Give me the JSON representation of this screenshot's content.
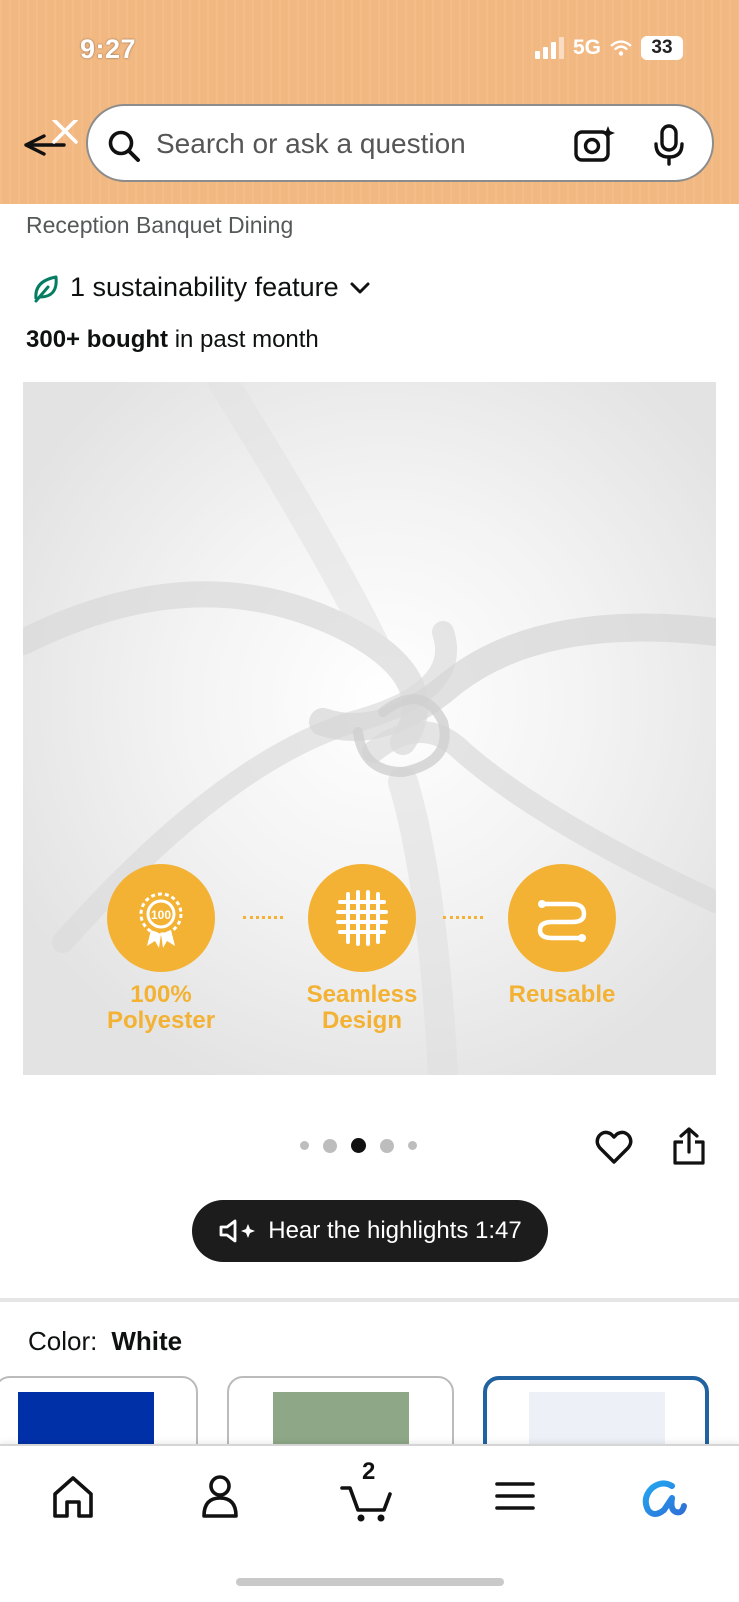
{
  "status_bar": {
    "time": "9:27",
    "network": "5G",
    "battery": "33"
  },
  "search": {
    "placeholder": "Search or ask a question"
  },
  "product": {
    "title_line": "Reception Banquet Dining",
    "sustainability": "1 sustainability feature",
    "bought_bold": "300+ bought",
    "bought_rest": " in past month",
    "image_features": [
      {
        "line1": "100%",
        "line2": "Polyester",
        "icon": "badge-100-icon"
      },
      {
        "line1": "Seamless",
        "line2": "Design",
        "icon": "grid-icon"
      },
      {
        "line1": "Reusable",
        "line2": "",
        "icon": "reuse-icon"
      }
    ],
    "badge_text": "100",
    "carousel": {
      "count": 5,
      "active_index": 2
    }
  },
  "highlights": {
    "label": "Hear the highlights 1:47"
  },
  "color": {
    "label": "Color:",
    "value": "White",
    "swatches": [
      {
        "name": "blue",
        "hex": "#0030a8",
        "selected": false
      },
      {
        "name": "sage",
        "hex": "#8ea887",
        "selected": false
      },
      {
        "name": "white",
        "hex": "#eef0f8",
        "selected": true
      }
    ]
  },
  "bottom_nav": {
    "cart_count": "2",
    "items": [
      "home-icon",
      "account-icon",
      "cart-icon",
      "menu-icon",
      "rufus-icon"
    ]
  },
  "colors": {
    "header_bg": "#f2b882",
    "feature_accent": "#f3b233",
    "selected_border": "#2162a1",
    "leaf_green": "#067d62"
  }
}
